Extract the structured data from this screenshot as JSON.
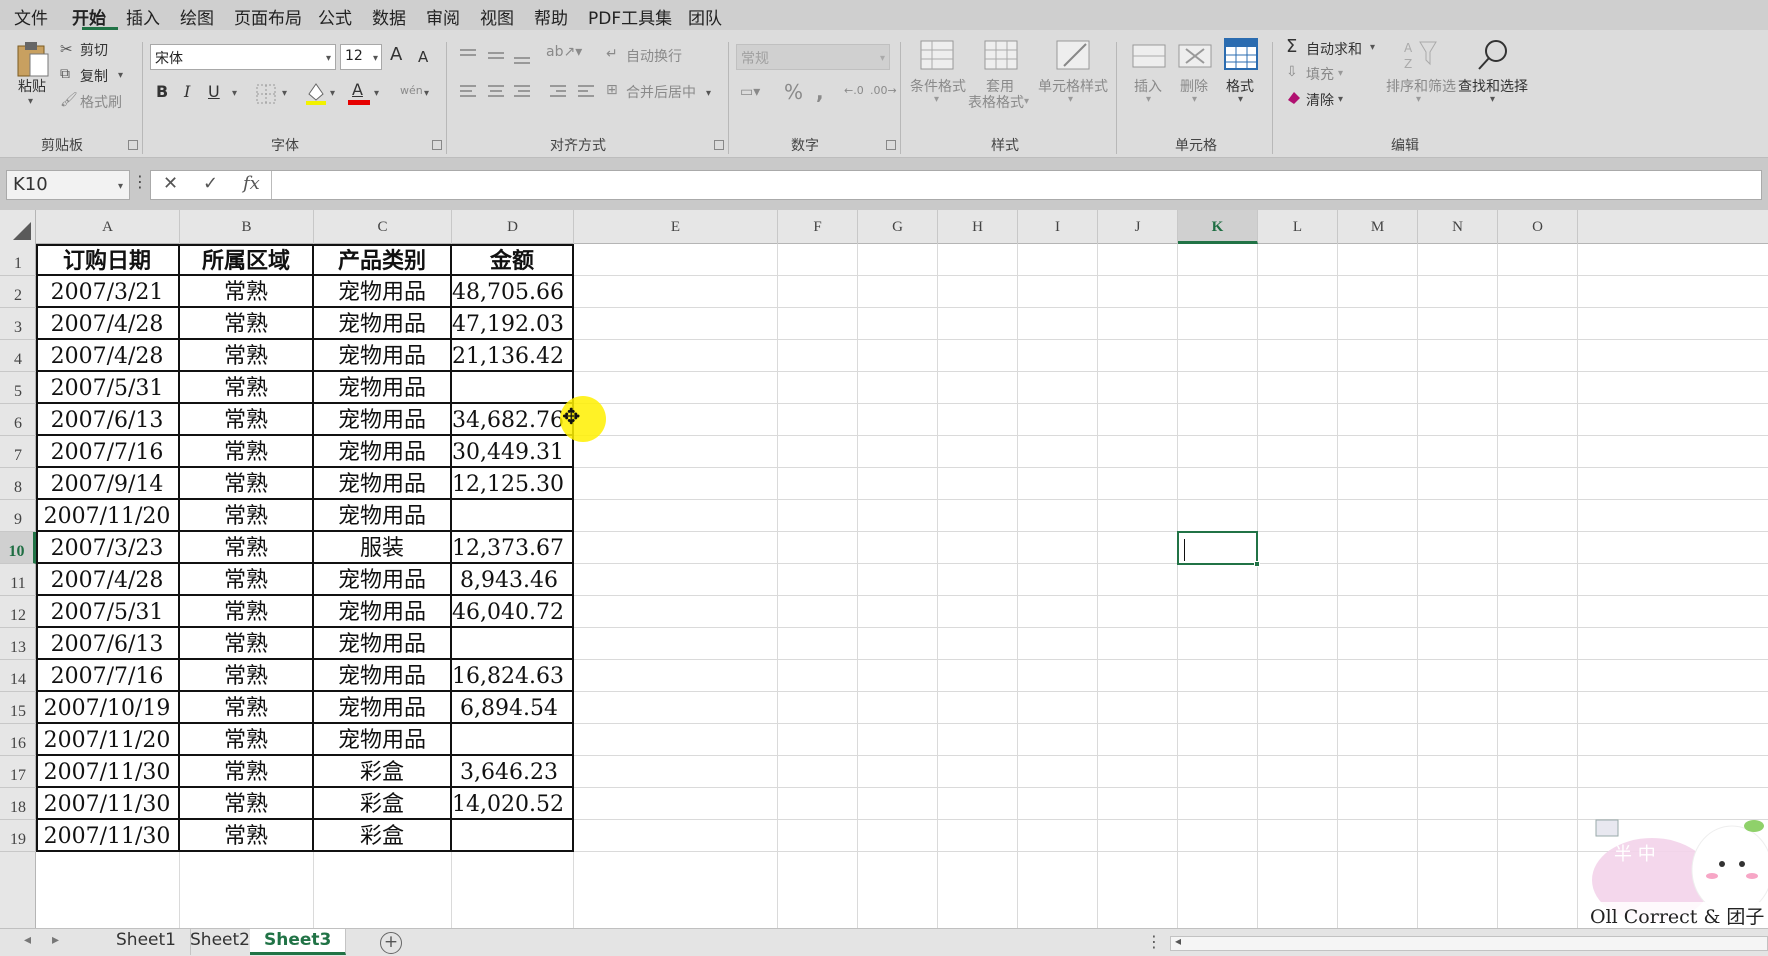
{
  "menu": {
    "items": [
      "文件",
      "开始",
      "插入",
      "绘图",
      "页面布局",
      "公式",
      "数据",
      "审阅",
      "视图",
      "帮助",
      "PDF工具集",
      "团队"
    ],
    "active_index": 1
  },
  "ribbon": {
    "clipboard": {
      "paste": "粘贴",
      "cut": "剪切",
      "copy": "复制",
      "format_painter": "格式刷",
      "label": "剪贴板"
    },
    "font": {
      "font_name": "宋体",
      "font_size": "12",
      "grow": "A",
      "shrink": "A",
      "bold": "B",
      "italic": "I",
      "underline": "U",
      "color_letter": "A",
      "label": "字体"
    },
    "alignment": {
      "wrap_text": "自动换行",
      "merge_center": "合并后居中",
      "label": "对齐方式"
    },
    "number": {
      "format": "常规",
      "percent": "%",
      "comma": ",",
      "label": "数字"
    },
    "styles": {
      "conditional": "条件格式",
      "table_format_1": "套用",
      "table_format_2": "表格格式",
      "cell_styles": "单元格样式",
      "label": "样式"
    },
    "cells": {
      "insert": "插入",
      "delete": "删除",
      "format": "格式",
      "label": "单元格"
    },
    "editing": {
      "autosum": "自动求和",
      "fill": "填充",
      "clear": "清除",
      "sort_filter": "排序和筛选",
      "find_select": "查找和选择",
      "label": "编辑"
    },
    "colors": {
      "font_color_bar": "#e60000",
      "fill_bar": "#f2f200",
      "clear_icon": "#b01070"
    }
  },
  "formula_bar": {
    "name_box": "K10",
    "cancel": "✕",
    "enter": "✓",
    "fx": "fx",
    "value": ""
  },
  "columns": [
    "A",
    "B",
    "C",
    "D",
    "E",
    "F",
    "G",
    "H",
    "I",
    "J",
    "K",
    "L",
    "M",
    "N",
    "O"
  ],
  "rows": [
    "1",
    "2",
    "3",
    "4",
    "5",
    "6",
    "7",
    "8",
    "9",
    "10",
    "11",
    "12",
    "13",
    "14",
    "15",
    "16",
    "17",
    "18",
    "19"
  ],
  "selected": {
    "column": "K",
    "row": "10"
  },
  "table": {
    "headers": [
      "订购日期",
      "所属区域",
      "产品类别",
      "金额"
    ],
    "rows": [
      [
        "2007/3/21",
        "常熟",
        "宠物用品",
        "48,705.66"
      ],
      [
        "2007/4/28",
        "常熟",
        "宠物用品",
        "47,192.03"
      ],
      [
        "2007/4/28",
        "常熟",
        "宠物用品",
        "21,136.42"
      ],
      [
        "2007/5/31",
        "常熟",
        "宠物用品",
        ""
      ],
      [
        "2007/6/13",
        "常熟",
        "宠物用品",
        "34,682.76"
      ],
      [
        "2007/7/16",
        "常熟",
        "宠物用品",
        "30,449.31"
      ],
      [
        "2007/9/14",
        "常熟",
        "宠物用品",
        "12,125.30"
      ],
      [
        "2007/11/20",
        "常熟",
        "宠物用品",
        ""
      ],
      [
        "2007/3/23",
        "常熟",
        "服装",
        "12,373.67"
      ],
      [
        "2007/4/28",
        "常熟",
        "宠物用品",
        "8,943.46"
      ],
      [
        "2007/5/31",
        "常熟",
        "宠物用品",
        "46,040.72"
      ],
      [
        "2007/6/13",
        "常熟",
        "宠物用品",
        ""
      ],
      [
        "2007/7/16",
        "常熟",
        "宠物用品",
        "16,824.63"
      ],
      [
        "2007/10/19",
        "常熟",
        "宠物用品",
        "6,894.54"
      ],
      [
        "2007/11/20",
        "常熟",
        "宠物用品",
        ""
      ],
      [
        "2007/11/30",
        "常熟",
        "彩盒",
        "3,646.23"
      ],
      [
        "2007/11/30",
        "常熟",
        "彩盒",
        "14,020.52"
      ],
      [
        "2007/11/30",
        "常熟",
        "彩盒",
        ""
      ]
    ]
  },
  "sheets": {
    "tabs": [
      "Sheet1",
      "Sheet2",
      "Sheet3"
    ],
    "active_index": 2
  },
  "watermark": {
    "caption": "Oll Correct & 团子",
    "badge": "半 中"
  },
  "theme": {
    "accent": "#217346",
    "highlight": "#fff000"
  }
}
